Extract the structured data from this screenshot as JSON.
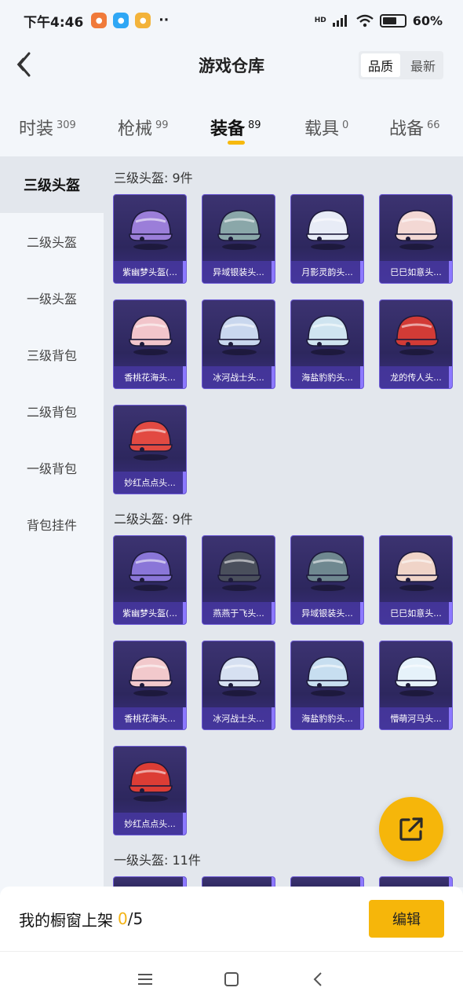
{
  "status_bar": {
    "time": "下午4:46",
    "network": "HD",
    "battery": "60%",
    "battery_level": 0.6
  },
  "header": {
    "title": "游戏仓库",
    "sort_options": [
      "品质",
      "最新"
    ],
    "sort_selected": "品质"
  },
  "tabs": [
    {
      "label": "时装",
      "count": "309"
    },
    {
      "label": "枪械",
      "count": "99"
    },
    {
      "label": "装备",
      "count": "89",
      "active": true
    },
    {
      "label": "载具",
      "count": "0"
    },
    {
      "label": "战备",
      "count": "66"
    }
  ],
  "sidebar": {
    "items": [
      "三级头盔",
      "二级头盔",
      "一级头盔",
      "三级背包",
      "二级背包",
      "一级背包",
      "背包挂件"
    ],
    "selected": "三级头盔"
  },
  "sections": [
    {
      "title": "三级头盔: 9件",
      "items": [
        {
          "name": "紫幽梦头盔(...",
          "color": "#9b7ed9"
        },
        {
          "name": "异域银装头...",
          "color": "#8aa7a9"
        },
        {
          "name": "月影灵韵头...",
          "color": "#e8ecf6"
        },
        {
          "name": "巳巳如意头...",
          "color": "#f3d8d4"
        },
        {
          "name": "香桃花海头...",
          "color": "#f2c5cb"
        },
        {
          "name": "冰河战士头...",
          "color": "#c9d7ee"
        },
        {
          "name": "海盐豹豹头...",
          "color": "#cfe4f0"
        },
        {
          "name": "龙的传人头...",
          "color": "#d23b36"
        },
        {
          "name": "妙红点点头...",
          "color": "#e24a42"
        }
      ]
    },
    {
      "title": "二级头盔: 9件",
      "items": [
        {
          "name": "紫幽梦头盔(...",
          "color": "#8a76d8"
        },
        {
          "name": "燕燕于飞头...",
          "color": "#4a4f5c"
        },
        {
          "name": "异域银装头...",
          "color": "#6f8890"
        },
        {
          "name": "巳巳如意头...",
          "color": "#f0d4c8"
        },
        {
          "name": "香桃花海头...",
          "color": "#f2c9cc"
        },
        {
          "name": "冰河战士头...",
          "color": "#d6e0f1"
        },
        {
          "name": "海盐豹豹头...",
          "color": "#c7def0"
        },
        {
          "name": "懵萌河马头...",
          "color": "#e6f2fa"
        },
        {
          "name": "妙红点点头...",
          "color": "#dc3d35"
        }
      ]
    },
    {
      "title": "一级头盔: 11件",
      "items": []
    }
  ],
  "showcase": {
    "label": "我的橱窗上架",
    "current": "0",
    "total": "/5"
  },
  "edit_label": "编辑",
  "colors": {
    "accent": "#f6b60a",
    "card_bg": "#2d275e",
    "card_border": "#6d5bd6"
  }
}
